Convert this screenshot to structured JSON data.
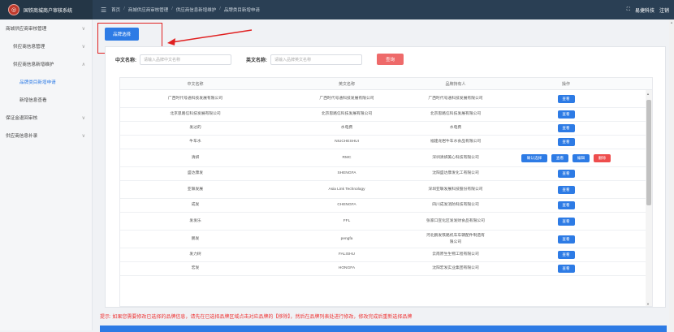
{
  "app": {
    "logo_glyph": "◎",
    "title": "国铁商城商户审核系统",
    "menu_icon": "☰",
    "fullscreen_icon": "⛶",
    "user": "易捷科技",
    "logout": "注销"
  },
  "breadcrumb": [
    "首页",
    "商城供应商审核管理",
    "供应商信息新增维护",
    "品牌类目新增申请"
  ],
  "sidebar": {
    "items": [
      {
        "label": "商城供应商审核管理",
        "level": 0,
        "chevron": "∨"
      },
      {
        "label": "供应商信息管理",
        "level": 1,
        "chevron": "∨"
      },
      {
        "label": "供应商信息新增维护",
        "level": 1,
        "chevron": "∧"
      },
      {
        "label": "品牌类目新增申请",
        "level": 2,
        "chevron": "",
        "active": true
      },
      {
        "label": "新增信息查看",
        "level": 2,
        "chevron": ""
      },
      {
        "label": "保证金退回审核",
        "level": 0,
        "chevron": "∨"
      },
      {
        "label": "供应商信息补录",
        "level": 0,
        "chevron": "∨"
      }
    ]
  },
  "toolbar": {
    "brand_select": "品牌选择"
  },
  "search": {
    "cn_label": "中文名称:",
    "cn_placeholder": "请输入品牌中文名称",
    "en_label": "英文名称:",
    "en_placeholder": "请输入品牌英文名称",
    "query_button": "查询"
  },
  "table": {
    "headers": [
      "中文名称",
      "英文名称",
      "品牌持有人",
      "操作"
    ],
    "rows": [
      {
        "cn": "广西时代号通科技发展有限公司",
        "en": "广西时代号通科技发展有限公司",
        "owner": "广西时代号通科技发展有限公司",
        "actions": [
          "查看"
        ]
      },
      {
        "cn": "北京思路信科技发展有限公司",
        "en": "北京思路信科技发展有限公司",
        "owner": "北京思路信科技发展有限公司",
        "actions": [
          "查看"
        ]
      },
      {
        "cn": "发过的",
        "en": "水电费",
        "owner": "水电费",
        "actions": [
          "查看"
        ]
      },
      {
        "cn": "牛车水",
        "en": "NIUCHESHUI",
        "owner": "福建龙岩牛车水食品有限公司",
        "actions": [
          "查看"
        ]
      },
      {
        "cn": "清妍",
        "en": "RMC",
        "owner": "深圳清妍美心科技有限公司",
        "actions": [
          "确认选择",
          "查看",
          "编辑",
          "删除"
        ]
      },
      {
        "cn": "盛达康发",
        "en": "SHENGFA",
        "owner": "沈阳盛达康发化工有限公司",
        "actions": [
          "查看"
        ]
      },
      {
        "cn": "亚联发展",
        "en": "Asia Link Technology",
        "owner": "深圳亚联发展科技股份有限公司",
        "actions": [
          "查看"
        ]
      },
      {
        "cn": "成发",
        "en": "CHENGFA",
        "owner": "四川成发消防科技有限公司",
        "actions": [
          "查看"
        ]
      },
      {
        "cn": "发发乐",
        "en": "FFL",
        "owner": "张家口宣化区发发财食品有限公司",
        "actions": [
          "查看"
        ]
      },
      {
        "cn": "鹏发",
        "en": "pengfa",
        "owner": "河北鹏发铁路机车车辆配件制造有限公司",
        "actions": [
          "查看"
        ]
      },
      {
        "cn": "发力树",
        "en": "FALISHU",
        "owner": "云南原生生物工程有限公司",
        "actions": [
          "查看"
        ]
      },
      {
        "cn": "宏发",
        "en": "HONGFA",
        "owner": "沈阳宏发实业集团有限公司",
        "actions": [
          "查看"
        ]
      }
    ]
  },
  "hint": "提示: 如果您需要修改已选择的品牌信息，请先在已选择品牌区域点击对应品牌的【移除】，然后在品牌列表处进行修改，修改完成后重新选择品牌",
  "colors": {
    "primary": "#2d7be5",
    "danger": "#ee4d4d",
    "topbar": "#2a3f54",
    "highlight_frame": "#e02020"
  }
}
